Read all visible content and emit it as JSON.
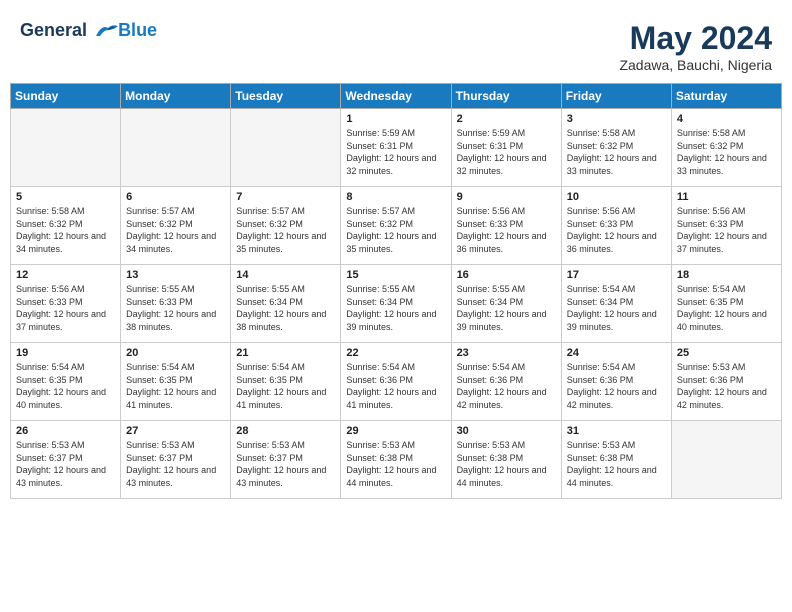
{
  "logo": {
    "line1": "General",
    "line2": "Blue"
  },
  "title": "May 2024",
  "subtitle": "Zadawa, Bauchi, Nigeria",
  "weekdays": [
    "Sunday",
    "Monday",
    "Tuesday",
    "Wednesday",
    "Thursday",
    "Friday",
    "Saturday"
  ],
  "weeks": [
    [
      {
        "day": "",
        "info": ""
      },
      {
        "day": "",
        "info": ""
      },
      {
        "day": "",
        "info": ""
      },
      {
        "day": "1",
        "info": "Sunrise: 5:59 AM\nSunset: 6:31 PM\nDaylight: 12 hours\nand 32 minutes."
      },
      {
        "day": "2",
        "info": "Sunrise: 5:59 AM\nSunset: 6:31 PM\nDaylight: 12 hours\nand 32 minutes."
      },
      {
        "day": "3",
        "info": "Sunrise: 5:58 AM\nSunset: 6:32 PM\nDaylight: 12 hours\nand 33 minutes."
      },
      {
        "day": "4",
        "info": "Sunrise: 5:58 AM\nSunset: 6:32 PM\nDaylight: 12 hours\nand 33 minutes."
      }
    ],
    [
      {
        "day": "5",
        "info": "Sunrise: 5:58 AM\nSunset: 6:32 PM\nDaylight: 12 hours\nand 34 minutes."
      },
      {
        "day": "6",
        "info": "Sunrise: 5:57 AM\nSunset: 6:32 PM\nDaylight: 12 hours\nand 34 minutes."
      },
      {
        "day": "7",
        "info": "Sunrise: 5:57 AM\nSunset: 6:32 PM\nDaylight: 12 hours\nand 35 minutes."
      },
      {
        "day": "8",
        "info": "Sunrise: 5:57 AM\nSunset: 6:32 PM\nDaylight: 12 hours\nand 35 minutes."
      },
      {
        "day": "9",
        "info": "Sunrise: 5:56 AM\nSunset: 6:33 PM\nDaylight: 12 hours\nand 36 minutes."
      },
      {
        "day": "10",
        "info": "Sunrise: 5:56 AM\nSunset: 6:33 PM\nDaylight: 12 hours\nand 36 minutes."
      },
      {
        "day": "11",
        "info": "Sunrise: 5:56 AM\nSunset: 6:33 PM\nDaylight: 12 hours\nand 37 minutes."
      }
    ],
    [
      {
        "day": "12",
        "info": "Sunrise: 5:56 AM\nSunset: 6:33 PM\nDaylight: 12 hours\nand 37 minutes."
      },
      {
        "day": "13",
        "info": "Sunrise: 5:55 AM\nSunset: 6:33 PM\nDaylight: 12 hours\nand 38 minutes."
      },
      {
        "day": "14",
        "info": "Sunrise: 5:55 AM\nSunset: 6:34 PM\nDaylight: 12 hours\nand 38 minutes."
      },
      {
        "day": "15",
        "info": "Sunrise: 5:55 AM\nSunset: 6:34 PM\nDaylight: 12 hours\nand 39 minutes."
      },
      {
        "day": "16",
        "info": "Sunrise: 5:55 AM\nSunset: 6:34 PM\nDaylight: 12 hours\nand 39 minutes."
      },
      {
        "day": "17",
        "info": "Sunrise: 5:54 AM\nSunset: 6:34 PM\nDaylight: 12 hours\nand 39 minutes."
      },
      {
        "day": "18",
        "info": "Sunrise: 5:54 AM\nSunset: 6:35 PM\nDaylight: 12 hours\nand 40 minutes."
      }
    ],
    [
      {
        "day": "19",
        "info": "Sunrise: 5:54 AM\nSunset: 6:35 PM\nDaylight: 12 hours\nand 40 minutes."
      },
      {
        "day": "20",
        "info": "Sunrise: 5:54 AM\nSunset: 6:35 PM\nDaylight: 12 hours\nand 41 minutes."
      },
      {
        "day": "21",
        "info": "Sunrise: 5:54 AM\nSunset: 6:35 PM\nDaylight: 12 hours\nand 41 minutes."
      },
      {
        "day": "22",
        "info": "Sunrise: 5:54 AM\nSunset: 6:36 PM\nDaylight: 12 hours\nand 41 minutes."
      },
      {
        "day": "23",
        "info": "Sunrise: 5:54 AM\nSunset: 6:36 PM\nDaylight: 12 hours\nand 42 minutes."
      },
      {
        "day": "24",
        "info": "Sunrise: 5:54 AM\nSunset: 6:36 PM\nDaylight: 12 hours\nand 42 minutes."
      },
      {
        "day": "25",
        "info": "Sunrise: 5:53 AM\nSunset: 6:36 PM\nDaylight: 12 hours\nand 42 minutes."
      }
    ],
    [
      {
        "day": "26",
        "info": "Sunrise: 5:53 AM\nSunset: 6:37 PM\nDaylight: 12 hours\nand 43 minutes."
      },
      {
        "day": "27",
        "info": "Sunrise: 5:53 AM\nSunset: 6:37 PM\nDaylight: 12 hours\nand 43 minutes."
      },
      {
        "day": "28",
        "info": "Sunrise: 5:53 AM\nSunset: 6:37 PM\nDaylight: 12 hours\nand 43 minutes."
      },
      {
        "day": "29",
        "info": "Sunrise: 5:53 AM\nSunset: 6:38 PM\nDaylight: 12 hours\nand 44 minutes."
      },
      {
        "day": "30",
        "info": "Sunrise: 5:53 AM\nSunset: 6:38 PM\nDaylight: 12 hours\nand 44 minutes."
      },
      {
        "day": "31",
        "info": "Sunrise: 5:53 AM\nSunset: 6:38 PM\nDaylight: 12 hours\nand 44 minutes."
      },
      {
        "day": "",
        "info": ""
      }
    ]
  ]
}
